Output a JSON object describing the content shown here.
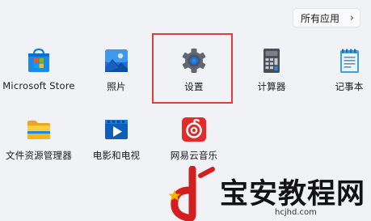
{
  "all_apps_button": {
    "label": "所有应用",
    "chevron": "›",
    "icon": "chevron-right-icon"
  },
  "apps": [
    {
      "label": "Microsoft Store",
      "icon": "microsoft-store-icon"
    },
    {
      "label": "照片",
      "icon": "photos-icon"
    },
    {
      "label": "设置",
      "icon": "settings-gear-icon"
    },
    {
      "label": "计算器",
      "icon": "calculator-icon"
    },
    {
      "label": "记事本",
      "icon": "notepad-icon"
    },
    {
      "label": "文件资源管理器",
      "icon": "file-explorer-icon"
    },
    {
      "label": "电影和电视",
      "icon": "movies-tv-icon"
    },
    {
      "label": "网易云音乐",
      "icon": "netease-music-icon"
    }
  ],
  "highlight": {
    "target": "设置",
    "color": "#e23b3b"
  },
  "watermark": {
    "text": "宝安教程网",
    "url": "hcjhd.com",
    "accent": "#d21f1f"
  }
}
